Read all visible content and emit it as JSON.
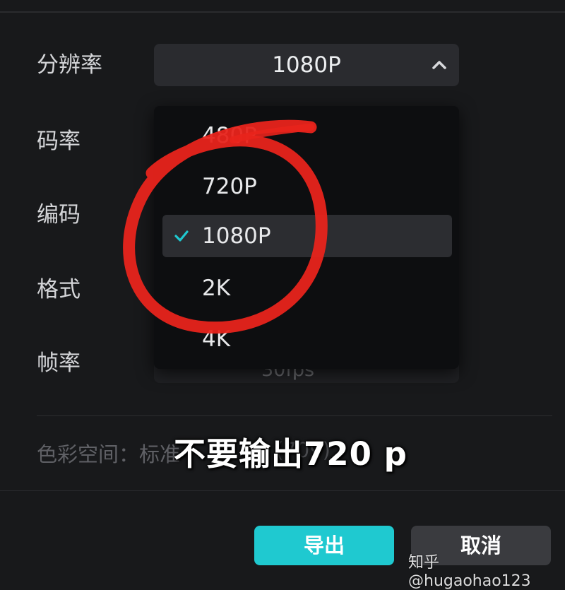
{
  "form": {
    "labels": {
      "resolution": "分辨率",
      "bitrate": "码率",
      "encoding": "编码",
      "format": "格式",
      "framerate": "帧率"
    },
    "resolution_value": "1080P",
    "framerate_value_partial": "30fps",
    "color_space_label": "色彩空间：标准",
    "color_space_value": "(709)"
  },
  "dropdown": {
    "options": [
      {
        "label": "480P",
        "selected": false
      },
      {
        "label": "720P",
        "selected": false
      },
      {
        "label": "1080P",
        "selected": true
      },
      {
        "label": "2K",
        "selected": false
      },
      {
        "label": "4K",
        "selected": false
      }
    ]
  },
  "caption": "不要输出720 p",
  "buttons": {
    "export": "导出",
    "cancel": "取消"
  },
  "watermark": "知乎 @hugaohao123",
  "colors": {
    "accent": "#1fc9d0",
    "annotation": "#e8241c",
    "background": "#18191b"
  },
  "icons": {
    "chevron": "chevron-up-icon",
    "check": "check-icon"
  }
}
